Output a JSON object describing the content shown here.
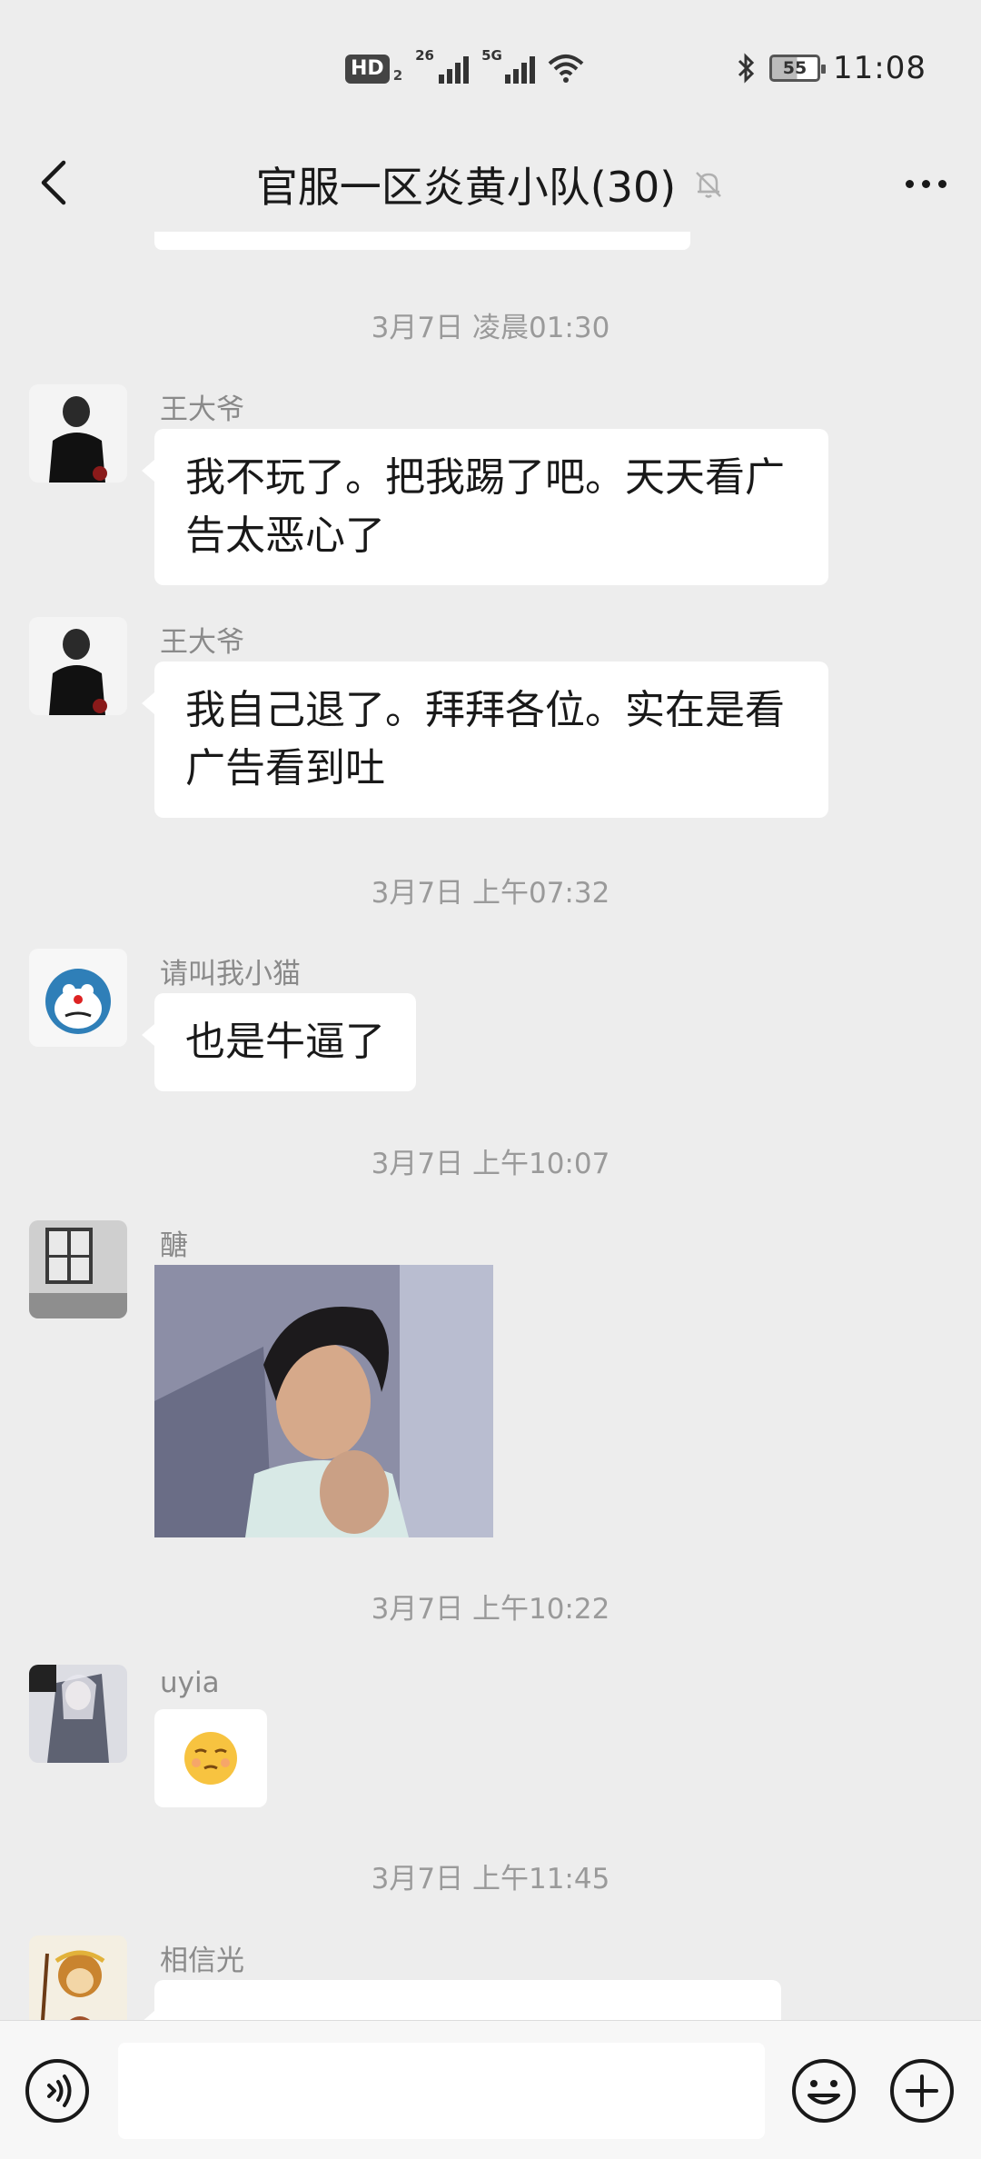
{
  "status_bar": {
    "hd": "HD",
    "hd_sub": "2",
    "net1": "26",
    "net2": "5G",
    "battery": "55",
    "time": "11:08"
  },
  "header": {
    "title": "官服一区炎黄小队(30)"
  },
  "timestamps": {
    "t1": "3月7日 凌晨01:30",
    "t2": "3月7日 上午07:32",
    "t3": "3月7日 上午10:07",
    "t4": "3月7日 上午10:22",
    "t5": "3月7日 上午11:45"
  },
  "messages": [
    {
      "sender": "王大爷",
      "text_line1": "我不玩了。把我踢了吧。天天看广",
      "text_line2": "告太恶心了"
    },
    {
      "sender": "王大爷",
      "text_line1": "我自己退了。拜拜各位。实在是看",
      "text_line2": "广告看到吐"
    },
    {
      "sender": "请叫我小猫",
      "text": "也是牛逼了"
    },
    {
      "sender": "醣"
    },
    {
      "sender": "uyia"
    },
    {
      "sender": "相信光"
    }
  ],
  "icons": {
    "back": "chevron-left",
    "mute": "bell-off",
    "more": "ellipsis",
    "voice": "voice-wave",
    "emoji": "smiley",
    "plus": "plus-circle",
    "sticker": "smirking-face"
  },
  "colors": {
    "background": "#ededed",
    "bubble": "#ffffff",
    "timestamp": "#9a9a9a"
  }
}
